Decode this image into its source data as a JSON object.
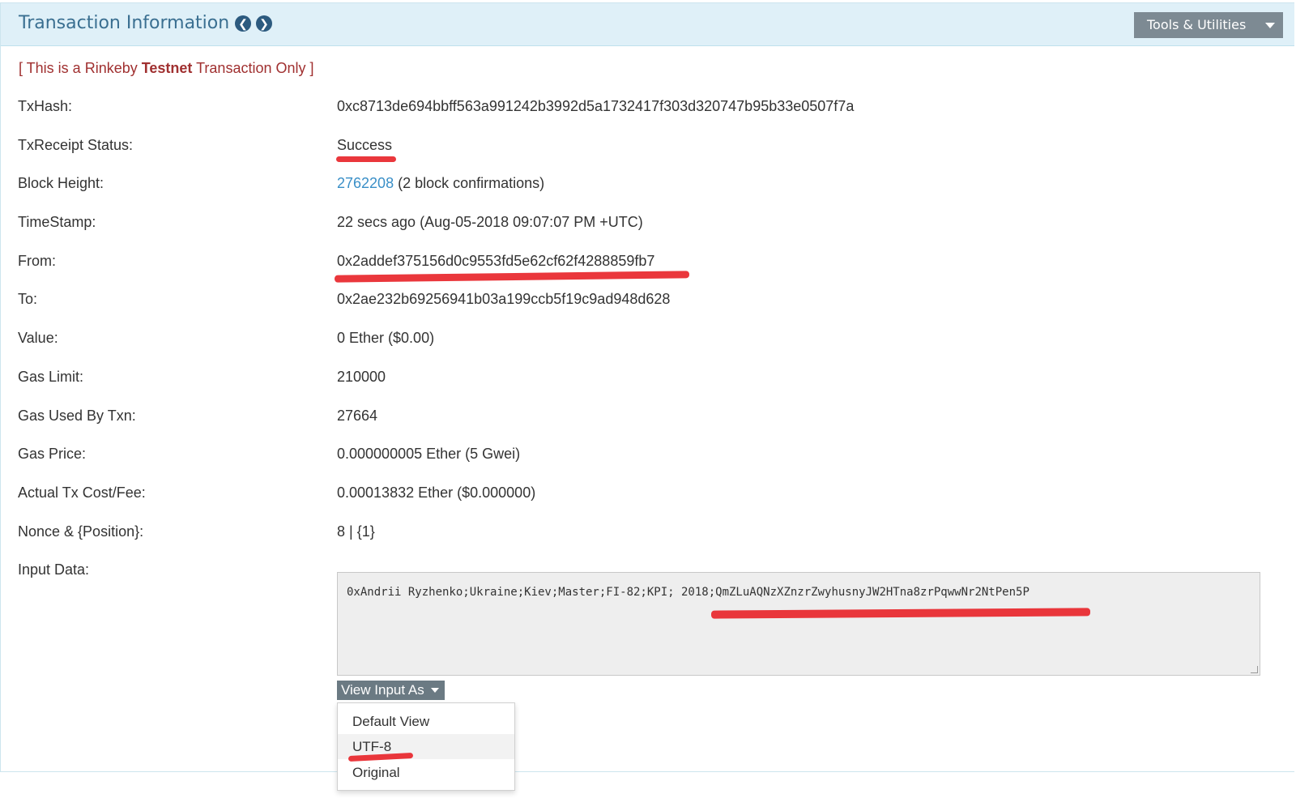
{
  "header": {
    "title": "Transaction Information",
    "prev_icon": "chevron-left-icon",
    "next_icon": "chevron-right-icon",
    "tools_label": "Tools & Utilities"
  },
  "notice": {
    "prefix": "[ This is a Rinkeby ",
    "bold": "Testnet",
    "suffix": " Transaction Only ]"
  },
  "fields": {
    "txhash": {
      "label": "TxHash:",
      "value": "0xc8713de694bbff563a991242b3992d5a1732417f303d320747b95b33e0507f7a"
    },
    "status": {
      "label": "TxReceipt Status:",
      "value": "Success"
    },
    "block": {
      "label": "Block Height:",
      "link": "2762208",
      "extra": " (2 block confirmations)"
    },
    "timestamp": {
      "label": "TimeStamp:",
      "value": "22 secs ago (Aug-05-2018 09:07:07 PM +UTC)"
    },
    "from": {
      "label": "From:",
      "value": "0x2addef375156d0c9553fd5e62cf62f4288859fb7"
    },
    "to": {
      "label": "To:",
      "value": "0x2ae232b69256941b03a199ccb5f19c9ad948d628"
    },
    "value": {
      "label": "Value:",
      "value": "0 Ether ($0.00)"
    },
    "gas_limit": {
      "label": "Gas Limit:",
      "value": "210000"
    },
    "gas_used": {
      "label": "Gas Used By Txn:",
      "value": "27664"
    },
    "gas_price": {
      "label": "Gas Price:",
      "value": "0.000000005 Ether (5 Gwei)"
    },
    "fee": {
      "label": "Actual Tx Cost/Fee:",
      "value": "0.00013832 Ether ($0.000000)"
    },
    "nonce": {
      "label": "Nonce & {Position}:",
      "value": "8 | {1}"
    },
    "input": {
      "label": "Input Data:",
      "value": "0xAndrii Ryzhenko;Ukraine;Kiev;Master;FI-82;KPI; 2018;QmZLuAQNzXZnzrZwyhusnyJW2HTna8zrPqwwNr2NtPen5P"
    }
  },
  "view_input": {
    "button_label": "View Input As",
    "options": [
      "Default View",
      "UTF-8",
      "Original"
    ]
  },
  "colors": {
    "header_bg": "#dff0f8",
    "title": "#3a6f91",
    "link": "#3a8fc7",
    "success": "#2e8b2e",
    "notice": "#a03030",
    "highlight_marker": "#e8262b"
  }
}
